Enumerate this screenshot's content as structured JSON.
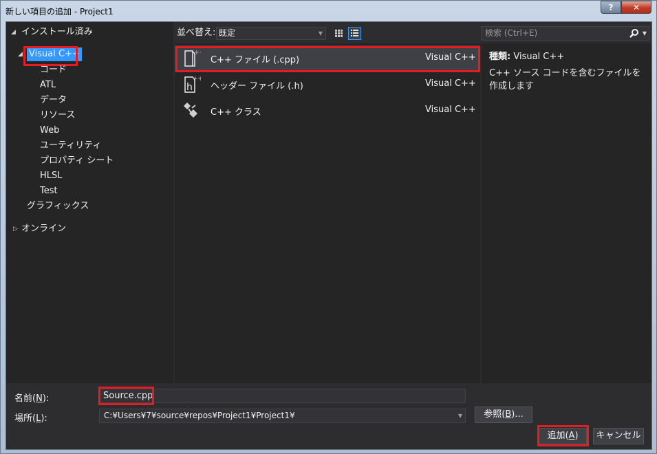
{
  "window": {
    "title": "新しい項目の追加 - Project1",
    "help_label": "?",
    "close_label": "✕"
  },
  "tree": {
    "installed": "インストール済み",
    "visual_cpp": "Visual C++",
    "children": [
      "コード",
      "ATL",
      "データ",
      "リソース",
      "Web",
      "ユーティリティ",
      "プロパティ シート",
      "HLSL",
      "Test"
    ],
    "graphics": "グラフィックス",
    "online": "オンライン"
  },
  "toolbar": {
    "sort_label": "並べ替え:",
    "sort_value": "既定"
  },
  "search": {
    "placeholder": "検索 (Ctrl+E)"
  },
  "templates": [
    {
      "name": "C++ ファイル (.cpp)",
      "category": "Visual C++",
      "icon": "cpp-file-icon"
    },
    {
      "name": "ヘッダー ファイル (.h)",
      "category": "Visual C++",
      "icon": "header-file-icon"
    },
    {
      "name": "C++ クラス",
      "category": "Visual C++",
      "icon": "cpp-class-icon"
    }
  ],
  "info": {
    "type_label": "種類:",
    "type_value": "Visual C++",
    "description": "C++ ソース コードを含むファイルを作成します"
  },
  "form": {
    "name_label_pre": "名前(",
    "name_label_key": "N",
    "name_label_post": "):",
    "name_value": "Source.cpp",
    "location_label_pre": "場所(",
    "location_label_key": "L",
    "location_label_post": "):",
    "location_value": "C:¥Users¥7¥source¥repos¥Project1¥Project1¥"
  },
  "buttons": {
    "browse_pre": "参照(",
    "browse_key": "B",
    "browse_post": ")...",
    "add_pre": "追加(",
    "add_key": "A",
    "add_post": ")",
    "cancel": "キャンセル"
  },
  "colors": {
    "background": "#2d2d30",
    "panel": "#252526",
    "selection": "#3399ff",
    "highlight_box": "#e51c23"
  }
}
